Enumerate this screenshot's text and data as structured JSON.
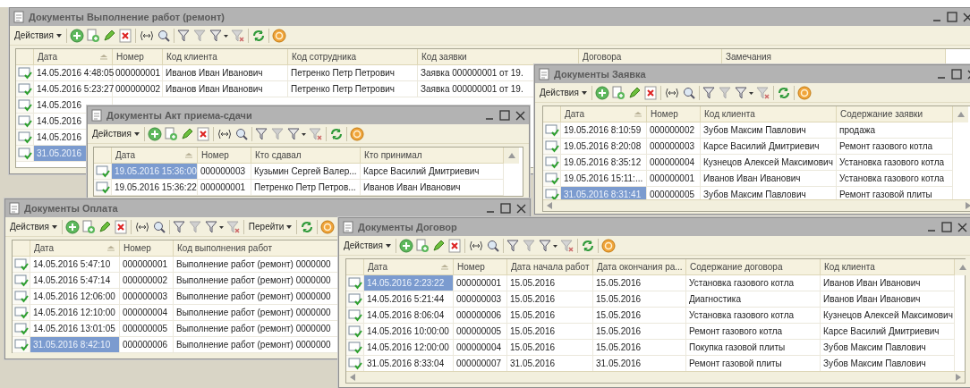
{
  "windows": [
    {
      "title": "Документы Выполнение работ (ремонт)",
      "actions_label": "Действия",
      "columns": [
        "Дата",
        "Номер",
        "Код клиента",
        "Код сотрудника",
        "Код заявки",
        "Договора",
        "Замечания"
      ],
      "rows": [
        {
          "selected": false,
          "cells": [
            "14.05.2016 4:48:05",
            "000000001",
            "Иванов Иван Иванович",
            "Петренко Петр Петрович",
            "Заявка 000000001 от 19."
          ]
        },
        {
          "selected": false,
          "cells": [
            "14.05.2016 5:23:27",
            "000000002",
            "Иванов Иван Иванович",
            "Петренко Петр Петрович",
            "Заявка 000000001 от 19."
          ]
        },
        {
          "selected": false,
          "cells": [
            "14.05.2016"
          ]
        },
        {
          "selected": false,
          "cells": [
            "14.05.2016"
          ]
        },
        {
          "selected": false,
          "cells": [
            "14.05.2016"
          ]
        },
        {
          "selected": true,
          "cells": [
            "31.05.2016"
          ]
        }
      ]
    },
    {
      "title": "Документы Заявка",
      "actions_label": "Действия",
      "columns": [
        "Дата",
        "Номер",
        "Код клиента",
        "Содержание заявки"
      ],
      "rows": [
        {
          "selected": false,
          "cells": [
            "19.05.2016 8:10:59",
            "000000002",
            "Зубов Максим Павлович",
            "продажа"
          ]
        },
        {
          "selected": false,
          "cells": [
            "19.05.2016 8:20:08",
            "000000003",
            "Карсе Василий Дмитриевич",
            "Ремонт газового котла"
          ]
        },
        {
          "selected": false,
          "cells": [
            "19.05.2016 8:35:12",
            "000000004",
            "Кузнецов Алексей Максимович",
            "Установка газового котла"
          ]
        },
        {
          "selected": false,
          "cells": [
            "19.05.2016 15:11:...",
            "000000001",
            "Иванов Иван Иванович",
            "Установка газового котла"
          ]
        },
        {
          "selected": true,
          "cells": [
            "31.05.2016 8:31:41",
            "000000005",
            "Зубов Максим Павлович",
            "Ремонт газовой плиты"
          ]
        }
      ]
    },
    {
      "title": "Документы Акт приема-сдачи",
      "actions_label": "Действия",
      "columns": [
        "Дата",
        "Номер",
        "Кто сдавал",
        "Кто принимал"
      ],
      "rows": [
        {
          "selected": true,
          "cells": [
            "19.05.2016 15:36:00",
            "000000003",
            "Кузьмин Сергей Валер...",
            "Карсе Василий Дмитриевич"
          ]
        },
        {
          "selected": false,
          "cells": [
            "19.05.2016 15:36:22",
            "000000001",
            "Петренко Петр Петров...",
            "Иванов Иван Иванович"
          ]
        }
      ]
    },
    {
      "title": "Документы Оплата",
      "actions_label": "Действия",
      "goto_label": "Перейти",
      "columns": [
        "Дата",
        "Номер",
        "Код выполнения работ"
      ],
      "rows": [
        {
          "selected": false,
          "cells": [
            "14.05.2016 5:47:10",
            "000000001",
            "Выполнение работ (ремонт) 0000000"
          ]
        },
        {
          "selected": false,
          "cells": [
            "14.05.2016 5:47:14",
            "000000002",
            "Выполнение работ (ремонт) 0000000"
          ]
        },
        {
          "selected": false,
          "cells": [
            "14.05.2016 12:06:00",
            "000000003",
            "Выполнение работ (ремонт) 0000000"
          ]
        },
        {
          "selected": false,
          "cells": [
            "14.05.2016 12:10:00",
            "000000004",
            "Выполнение работ (ремонт) 0000000"
          ]
        },
        {
          "selected": false,
          "cells": [
            "14.05.2016 13:01:05",
            "000000005",
            "Выполнение работ (ремонт) 0000000"
          ]
        },
        {
          "selected": true,
          "cells": [
            "31.05.2016 8:42:10",
            "000000006",
            "Выполнение работ (ремонт) 0000000"
          ]
        }
      ]
    },
    {
      "title": "Документы Договор",
      "actions_label": "Действия",
      "columns": [
        "Дата",
        "Номер",
        "Дата начала работ",
        "Дата окончания ра...",
        "Содержание договора",
        "Код клиента"
      ],
      "rows": [
        {
          "selected": true,
          "cells": [
            "14.05.2016 2:23:22",
            "000000001",
            "15.05.2016",
            "15.05.2016",
            "Установка газового котла",
            "Иванов Иван Иванович"
          ]
        },
        {
          "selected": false,
          "cells": [
            "14.05.2016 5:21:44",
            "000000003",
            "15.05.2016",
            "15.05.2016",
            "Диагностика",
            "Иванов Иван Иванович"
          ]
        },
        {
          "selected": false,
          "cells": [
            "14.05.2016 8:06:04",
            "000000006",
            "15.05.2016",
            "15.05.2016",
            "Установка газового котла",
            "Кузнецов Алексей Максимович"
          ]
        },
        {
          "selected": false,
          "cells": [
            "14.05.2016 10:00:00",
            "000000005",
            "15.05.2016",
            "15.05.2016",
            "Ремонт газового котла",
            "Карсе Василий Дмитриевич"
          ]
        },
        {
          "selected": false,
          "cells": [
            "14.05.2016 12:00:00",
            "000000004",
            "15.05.2016",
            "15.05.2016",
            "Покупка газовой плиты",
            "Зубов Максим Павлович"
          ]
        },
        {
          "selected": false,
          "cells": [
            "31.05.2016 8:33:04",
            "000000007",
            "31.05.2016",
            "31.05.2016",
            "Ремонт газовой плиты",
            "Зубов Максим Павлович"
          ]
        }
      ]
    }
  ]
}
